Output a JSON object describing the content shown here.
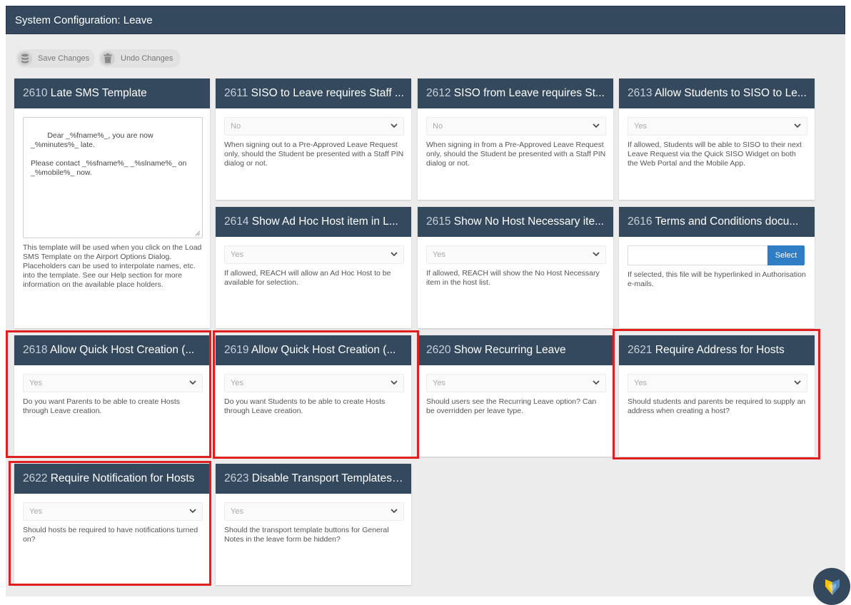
{
  "header": {
    "title": "System Configuration: Leave"
  },
  "toolbar": {
    "save_label": "Save Changes",
    "undo_label": "Undo Changes"
  },
  "cards": {
    "c2610": {
      "num": "2610",
      "title": "Late SMS Template",
      "template": "Dear _%fname%_, you are now _%minutes%_ late.\n\nPlease contact _%sfname%_ _%slname%_ on _%mobile%_ now.",
      "desc": "This template will be used when you click on the Load SMS Template on the Airport Options Dialog. Placeholders can be used to interpolate names, etc. into the template. See our Help section for more information on the available place holders."
    },
    "c2611": {
      "num": "2611",
      "title": "SISO to Leave requires Staff ...",
      "value": "No",
      "desc": "When signing out to a Pre-Approved Leave Request only, should the Student be presented with a Staff PIN dialog or not."
    },
    "c2612": {
      "num": "2612",
      "title": "SISO from Leave requires St...",
      "value": "No",
      "desc": "When signing in from a Pre-Approved Leave Request only, should the Student be presented with a Staff PIN dialog or not."
    },
    "c2613": {
      "num": "2613",
      "title": "Allow Students to SISO to Le...",
      "value": "Yes",
      "desc": "If allowed, Students will be able to SISO to their next Leave Request via the Quick SISO Widget on both the Web Portal and the Mobile App."
    },
    "c2614": {
      "num": "2614",
      "title": "Show Ad Hoc Host item in L...",
      "value": "Yes",
      "desc": "If allowed, REACH will allow an Ad Hoc Host to be available for selection."
    },
    "c2615": {
      "num": "2615",
      "title": "Show No Host Necessary ite...",
      "value": "Yes",
      "desc": "If allowed, REACH will show the No Host Necessary item in the host list."
    },
    "c2616": {
      "num": "2616",
      "title": "Terms and Conditions docu...",
      "button": "Select",
      "desc": "If selected, this file will be hyperlinked in Authorisation e-mails."
    },
    "c2618": {
      "num": "2618",
      "title": "Allow Quick Host Creation (...",
      "value": "Yes",
      "desc": "Do you want Parents to be able to create Hosts through Leave creation."
    },
    "c2619": {
      "num": "2619",
      "title": "Allow Quick Host Creation (...",
      "value": "Yes",
      "desc": "Do you want Students to be able to create Hosts through Leave creation."
    },
    "c2620": {
      "num": "2620",
      "title": "Show Recurring Leave",
      "value": "Yes",
      "desc": "Should users see the Recurring Leave option? Can be overridden per leave type."
    },
    "c2621": {
      "num": "2621",
      "title": "Require Address for Hosts",
      "value": "Yes",
      "desc": "Should students and parents be required to supply an address when creating a host?"
    },
    "c2622": {
      "num": "2622",
      "title": "Require Notification for Hosts",
      "value": "Yes",
      "desc": "Should hosts be required to have notifications turned on?"
    },
    "c2623": {
      "num": "2623",
      "title": "Disable Transport Templates ...",
      "value": "Yes",
      "desc": "Should the transport template buttons for General Notes in the leave form be hidden?"
    }
  },
  "colors": {
    "header_bg": "#34495e",
    "highlight": "#e02020",
    "select_button": "#2f7ec5"
  },
  "icons": {
    "save": "database-icon",
    "undo": "trash-icon",
    "dropdown": "chevron-down-icon",
    "help": "help-widget-icon"
  }
}
